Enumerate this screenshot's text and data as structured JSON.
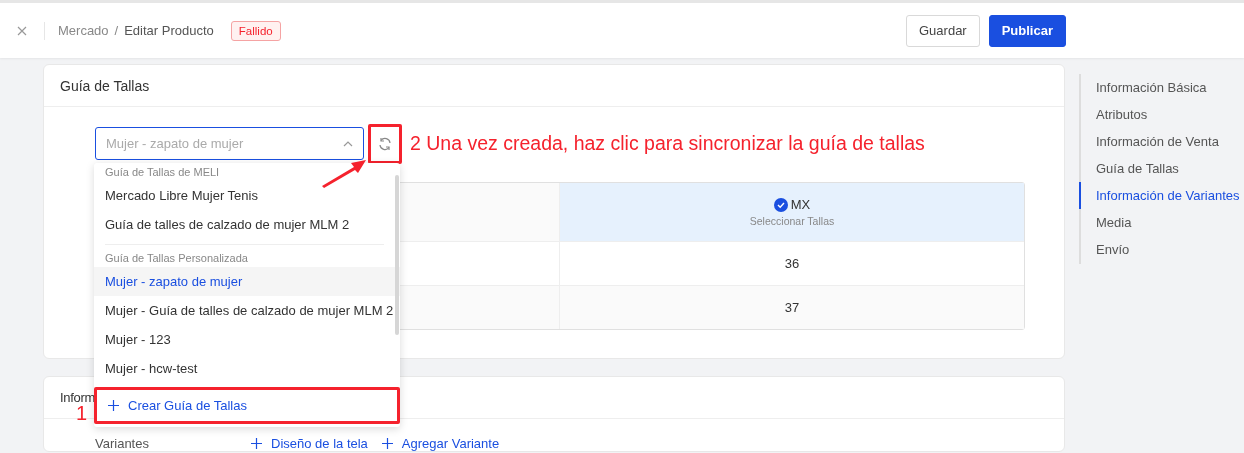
{
  "header": {
    "breadcrumb": [
      "Mercado",
      "Editar Producto"
    ],
    "breadcrumb_separator": "/",
    "status_badge": "Fallido",
    "buttons": [
      {
        "label": "Guardar",
        "kind": "secondary"
      },
      {
        "label": "Publicar",
        "kind": "primary"
      }
    ]
  },
  "size_guide_card": {
    "title": "Guía de Tallas",
    "select": {
      "placeholder": "Mujer - zapato de mujer",
      "expanded": true
    },
    "annotation_step_2": "2 Una vez creada, haz clic para sincronizar la guía de tallas",
    "table": {
      "column_2": {
        "checked": true,
        "title": "MX",
        "subtitle": "Seleccionar Tallas"
      },
      "rows": [
        {
          "column_2": "36"
        },
        {
          "column_2": "37"
        }
      ]
    }
  },
  "dropdown": {
    "groups": [
      {
        "label": "Guía de Tallas de MELI",
        "options": [
          {
            "label": "Mercado Libre Mujer Tenis",
            "selected": false
          },
          {
            "label": "Guía de talles de calzado de mujer MLM 2",
            "selected": false
          }
        ]
      },
      {
        "label": "Guía de Tallas Personalizada",
        "options": [
          {
            "label": "Mujer - zapato de mujer",
            "selected": true
          },
          {
            "label": "Mujer - Guía de talles de calzado de mujer MLM 2",
            "selected": false
          },
          {
            "label": "Mujer - 123",
            "selected": false
          },
          {
            "label": "Mujer - hcw-test",
            "selected": false
          }
        ]
      }
    ],
    "create_button": "Crear Guía de Tallas",
    "annotation_step_1": "1"
  },
  "variants_card": {
    "title": "Inform",
    "row_label": "Variantes",
    "links": [
      "Diseño de la tela",
      "Agregar Variante"
    ]
  },
  "side_nav": [
    {
      "label": "Información Básica",
      "selected": false
    },
    {
      "label": "Atributos",
      "selected": false
    },
    {
      "label": "Información de Venta",
      "selected": false
    },
    {
      "label": "Guía de Tallas",
      "selected": false
    },
    {
      "label": "Información de Variantes",
      "selected": true
    },
    {
      "label": "Media",
      "selected": false
    },
    {
      "label": "Envío",
      "selected": false
    }
  ]
}
